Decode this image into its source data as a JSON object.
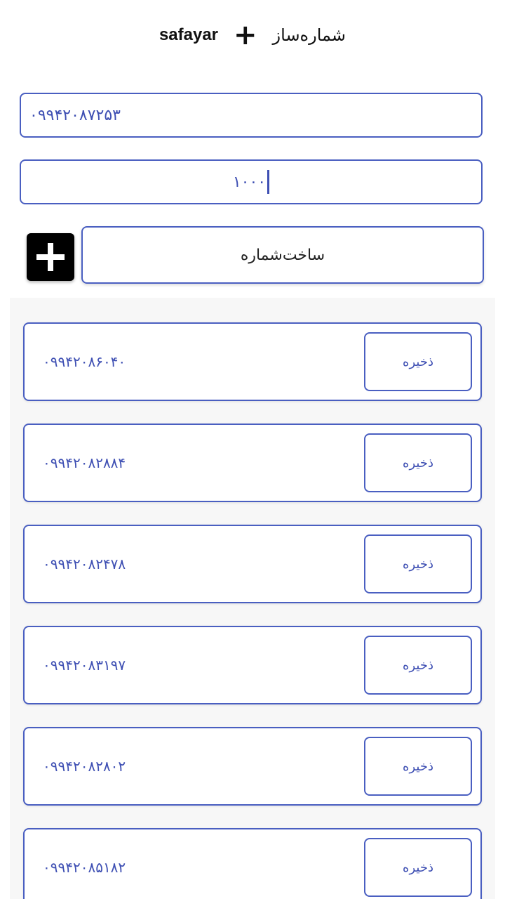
{
  "header": {
    "brand": "safayar",
    "plus": "+",
    "title": "شماره‌ساز"
  },
  "form": {
    "start_number": "۰۹۹۴۲۰۸۷۲۵۳",
    "count": "۱۰۰۰",
    "generate_label": "ساخت‌شماره",
    "add_icon": "plus-icon"
  },
  "colors": {
    "accent": "#4a5fc1",
    "text_blue": "#3e4fb3",
    "panel_bg": "#f7f7f7",
    "add_button_bg": "#000000"
  },
  "results": [
    {
      "number": "۰۹۹۴۲۰۸۶۰۴۰",
      "save_label": "ذخیره"
    },
    {
      "number": "۰۹۹۴۲۰۸۲۸۸۴",
      "save_label": "ذخیره"
    },
    {
      "number": "۰۹۹۴۲۰۸۲۴۷۸",
      "save_label": "ذخیره"
    },
    {
      "number": "۰۹۹۴۲۰۸۳۱۹۷",
      "save_label": "ذخیره"
    },
    {
      "number": "۰۹۹۴۲۰۸۲۸۰۲",
      "save_label": "ذخیره"
    },
    {
      "number": "۰۹۹۴۲۰۸۵۱۸۲",
      "save_label": "ذخیره"
    }
  ]
}
